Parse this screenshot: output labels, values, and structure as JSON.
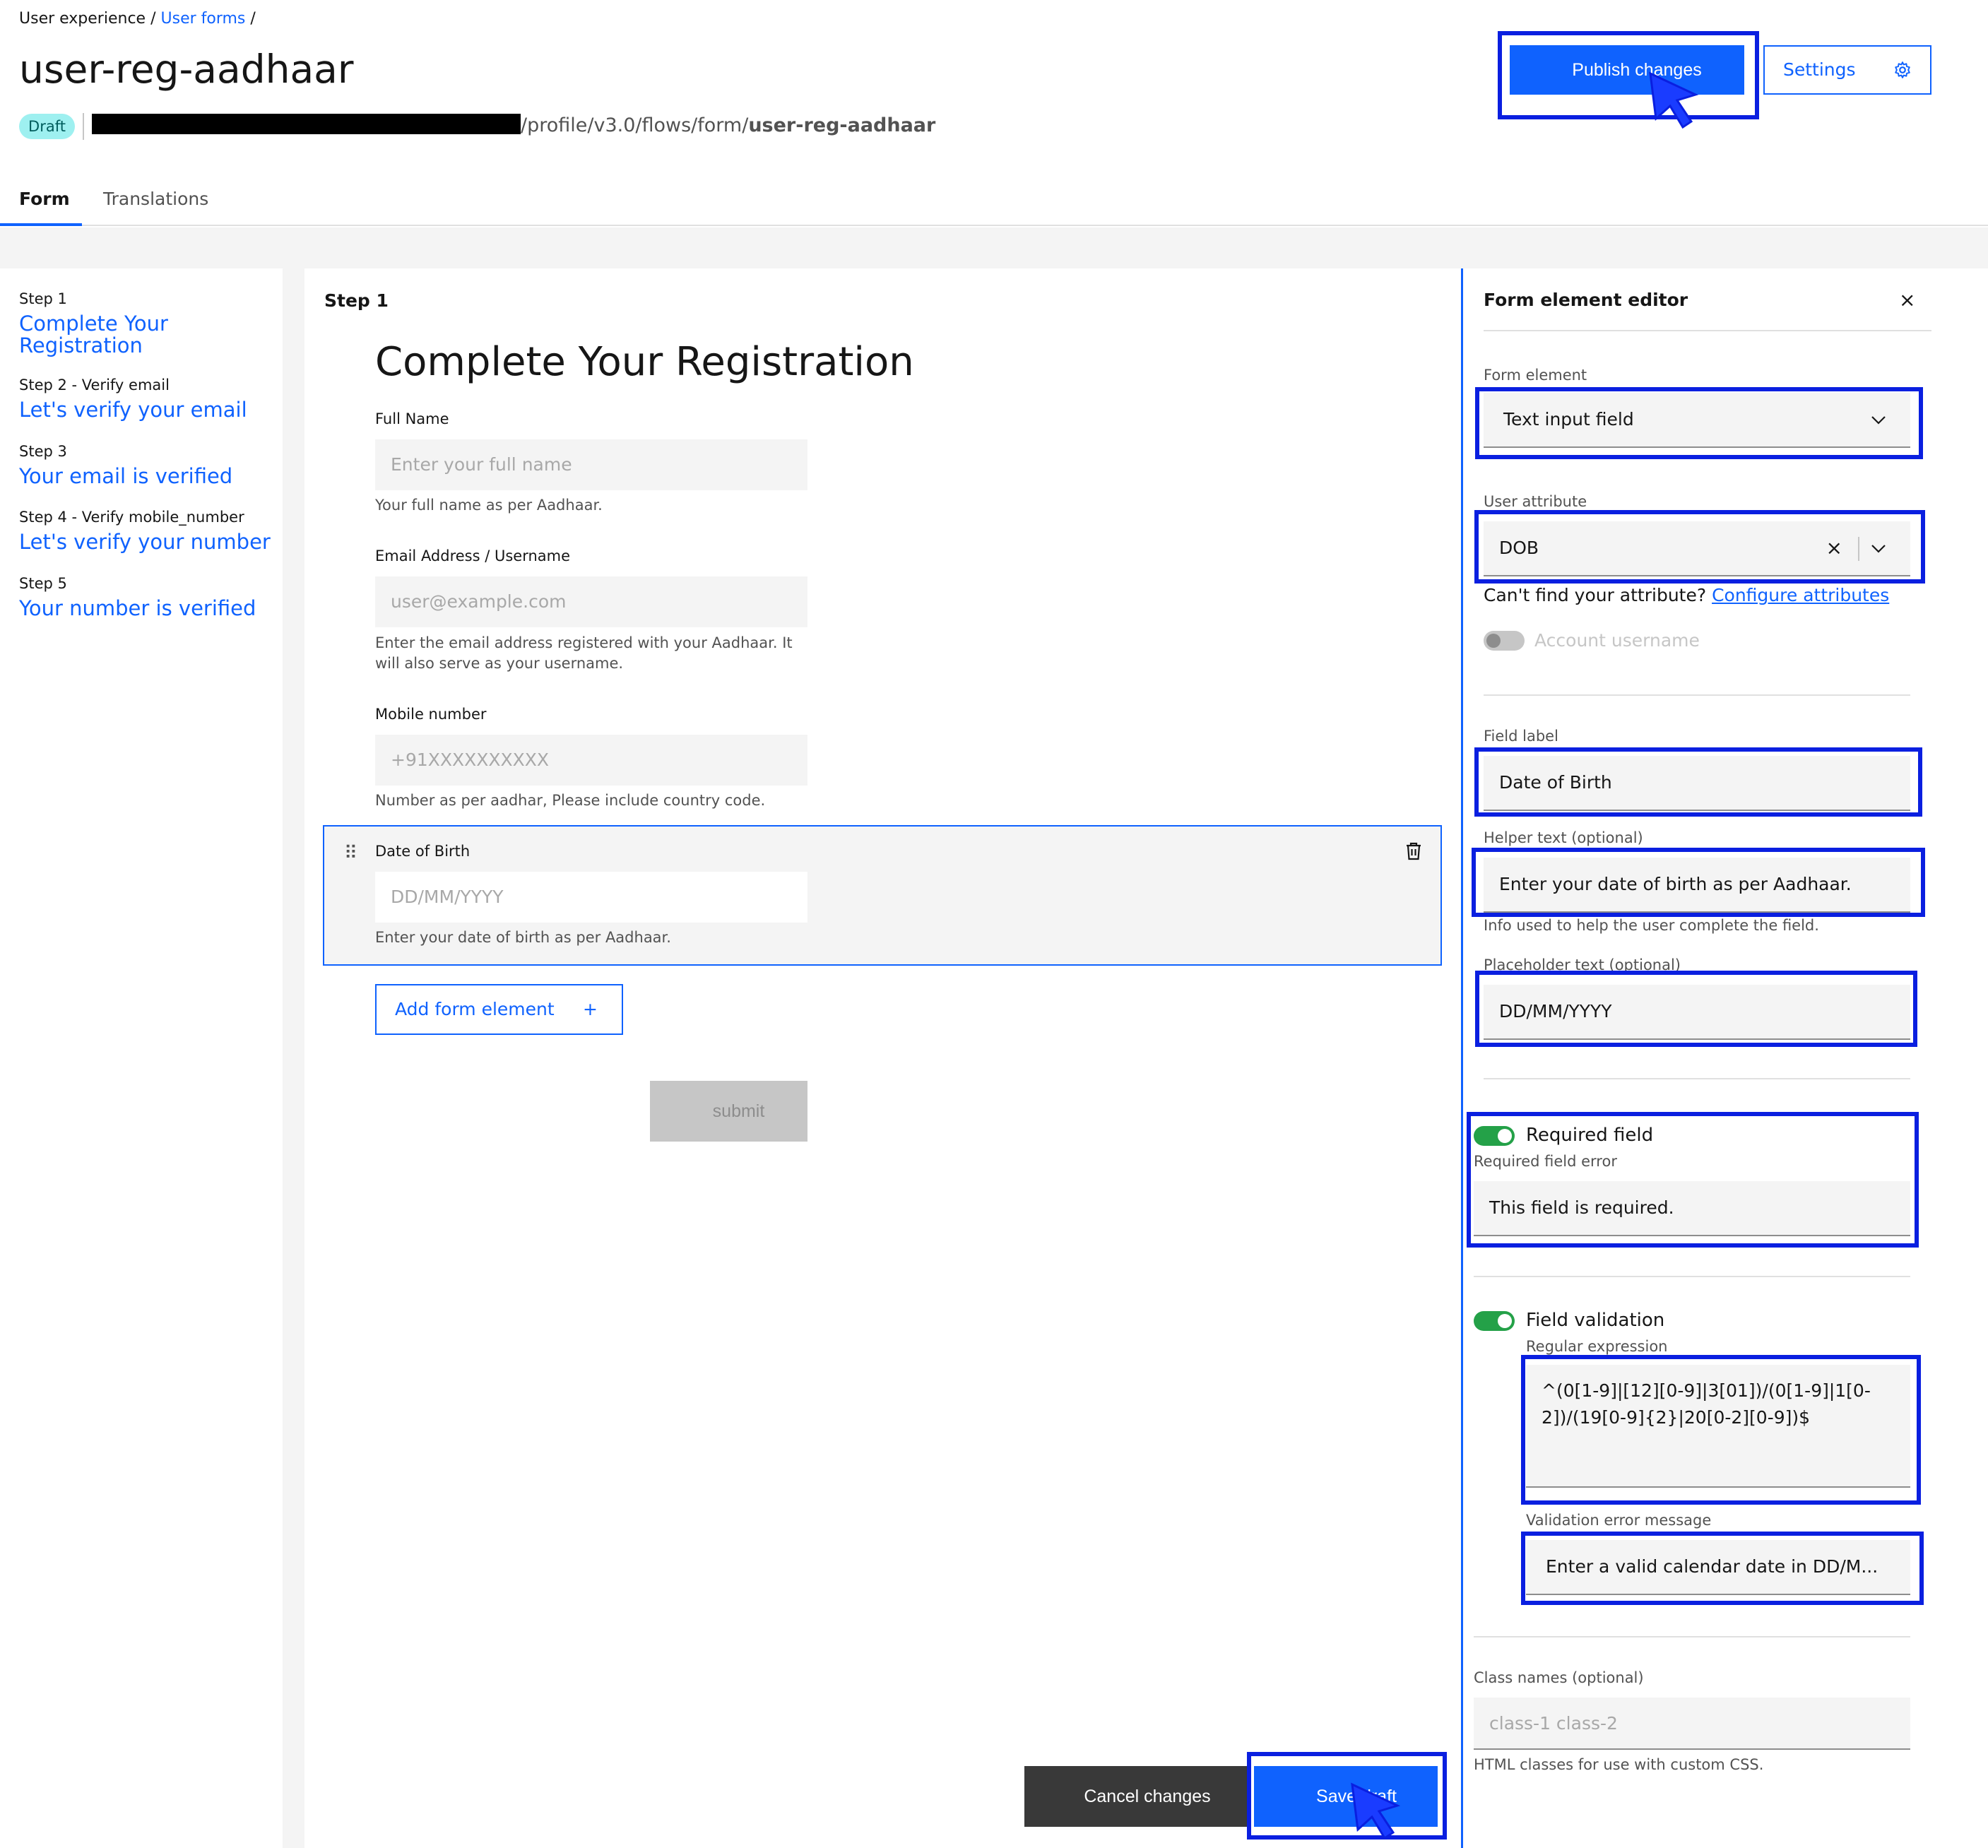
{
  "breadcrumb": {
    "root": "User experience",
    "separator": "/",
    "current": "User forms"
  },
  "page": {
    "title": "user-reg-aadhaar",
    "status": "Draft",
    "url_path_prefix": "/profile/v3.0/flows/form/",
    "url_path_name": "user-reg-aadhaar"
  },
  "header": {
    "publish_label": "Publish changes",
    "settings_label": "Settings"
  },
  "tabs": [
    {
      "label": "Form",
      "active": true
    },
    {
      "label": "Translations",
      "active": false
    }
  ],
  "steps": [
    {
      "caption": "Step 1",
      "title": "Complete Your Registration"
    },
    {
      "caption": "Step 2 - Verify email",
      "title": "Let's verify your email"
    },
    {
      "caption": "Step 3",
      "title": "Your email is verified"
    },
    {
      "caption": "Step 4 - Verify mobile_number",
      "title": "Let's verify your number"
    },
    {
      "caption": "Step 5",
      "title": "Your number is verified"
    }
  ],
  "canvas": {
    "step_label": "Step 1",
    "heading": "Complete Your Registration",
    "fields": [
      {
        "label": "Full Name",
        "placeholder": "Enter your full name",
        "helper": "Your full name as per Aadhaar."
      },
      {
        "label": "Email Address / Username",
        "placeholder": "user@example.com",
        "helper": "Enter the email address registered with your Aadhaar. It will also serve as your username."
      },
      {
        "label": "Mobile number",
        "placeholder": "+91XXXXXXXXXX",
        "helper": "Number as per aadhar, Please include country code."
      },
      {
        "label": "Date of Birth",
        "placeholder": "DD/MM/YYYY",
        "helper": "Enter your date of birth as per Aadhaar."
      }
    ],
    "add_element_label": "Add form element",
    "add_icon": "+",
    "submit_label": "submit"
  },
  "footer": {
    "cancel_label": "Cancel changes",
    "save_label": "Save draft"
  },
  "editor": {
    "title": "Form element editor",
    "close_icon": "×",
    "form_element_label": "Form element",
    "form_element_value": "Text input field",
    "user_attribute_label": "User attribute",
    "user_attribute_value": "DOB",
    "clear_icon": "×",
    "cant_find_text": "Can't find your attribute?",
    "configure_link": "Configure attributes",
    "account_username_label": "Account username",
    "field_label_label": "Field label",
    "field_label_value": "Date of Birth",
    "helper_label": "Helper text (optional)",
    "helper_value": "Enter your date of birth as per Aadhaar.",
    "helper_info": "Info used to help the user complete the field.",
    "placeholder_label": "Placeholder text (optional)",
    "placeholder_value": "DD/MM/YYYY",
    "required_title": "Required field",
    "required_error_label": "Required field error",
    "required_error_value": "This field is required.",
    "validation_title": "Field validation",
    "regex_label": "Regular expression",
    "regex_value": "^(0[1-9]|[12][0-9]|3[01])/(0[1-9]|1[0-2])/(19[0-9]{2}|20[0-2][0-9])$",
    "validation_error_label": "Validation error message",
    "validation_error_value": "Enter a valid calendar date in DD/M...",
    "class_label": "Class names (optional)",
    "class_placeholder": "class-1 class-2",
    "class_helper": "HTML classes for use with custom CSS."
  },
  "colors": {
    "accent": "#0f62fe",
    "annotation": "#0a1fe0",
    "toggle_on": "#24a148",
    "badge_bg": "#9ef0f0"
  }
}
